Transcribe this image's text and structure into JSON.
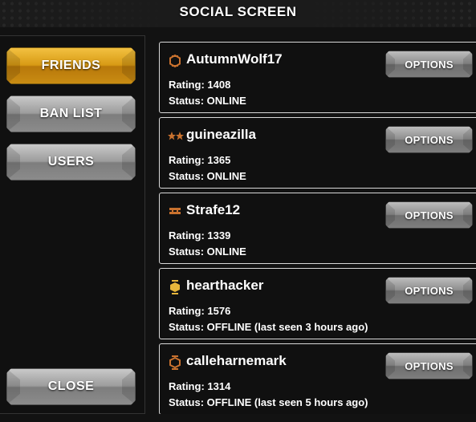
{
  "header": {
    "title": "SOCIAL SCREEN"
  },
  "sidebar": {
    "items": [
      {
        "label": "FRIENDS",
        "active": true
      },
      {
        "label": "BAN LIST",
        "active": false
      },
      {
        "label": "USERS",
        "active": false
      }
    ],
    "close_label": "CLOSE"
  },
  "labels": {
    "rating_prefix": "Rating: ",
    "status_prefix": "Status: ",
    "options": "OPTIONS"
  },
  "friends": [
    {
      "name": "AutumnWolf17",
      "rating": "1408",
      "status": "ONLINE",
      "rank_icon": "bronze-hex-rank-icon"
    },
    {
      "name": "guineazilla",
      "rating": "1365",
      "status": "ONLINE",
      "rank_icon": "two-stars-rank-icon"
    },
    {
      "name": "Strafe12",
      "rating": "1339",
      "status": "ONLINE",
      "rank_icon": "bronze-bars-rank-icon"
    },
    {
      "name": "hearthacker",
      "rating": "1576",
      "status": "OFFLINE (last seen 3 hours ago)",
      "rank_icon": "gold-hex-rank-icon"
    },
    {
      "name": "calleharnemark",
      "rating": "1314",
      "status": "OFFLINE (last seen 5 hours ago)",
      "rank_icon": "bronze-hex-rank-icon"
    }
  ],
  "colors": {
    "active_button": "#d89a14",
    "inactive_button": "#9c9c9c",
    "bronze": "#c8712e",
    "gold": "#e7b63b"
  }
}
